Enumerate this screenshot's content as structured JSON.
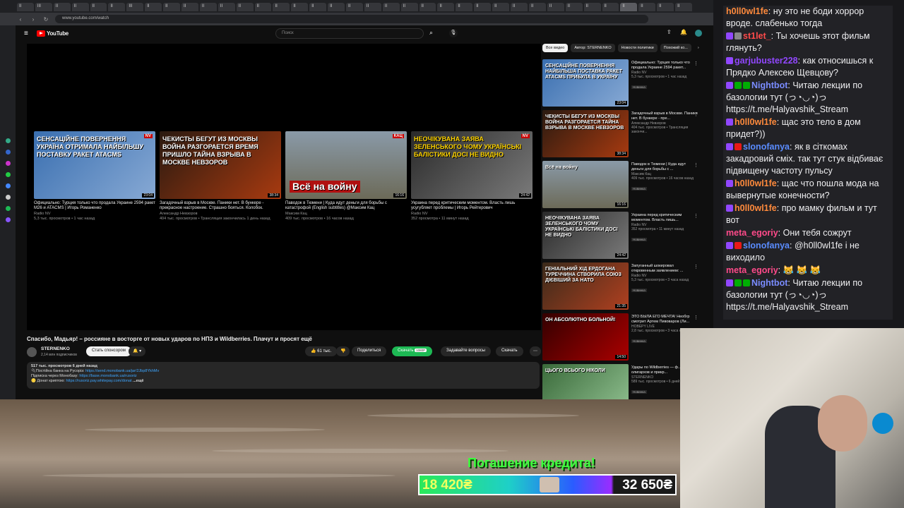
{
  "browser": {
    "tabs": [
      "II",
      "III",
      "II",
      "II",
      "II",
      "II",
      "III",
      "II",
      "II",
      "II",
      "II",
      "II",
      "II",
      "II",
      "II",
      "II",
      "II",
      "II",
      "II",
      "II",
      "II",
      "II",
      "II",
      "II",
      "II",
      "II",
      "II",
      "II",
      "II",
      "II",
      "II",
      "II",
      "II",
      "II",
      "II",
      "II",
      "II"
    ],
    "address": "www.youtube.com/watch"
  },
  "youtube": {
    "logo_text": "YouTube",
    "search_placeholder": "Поиск",
    "end_cards": [
      {
        "overlay": "СЕНСАЦІЙНЕ ПОВЕРНЕННЯ УКРАЇНА ОТРИМАЛА НАЙБІЛЬШУ ПОСТАВКУ РАКЕТ ATACMS",
        "badge": "NV",
        "duration": "23:04",
        "title": "Официально: Турция только что продала Украине 2594 ракет M26 и ATACMS | Игорь Романенко",
        "channel": "Radio NV",
        "meta": "5,3 тыс. просмотров • 1 час назад",
        "bg": "linear-gradient(135deg,#3a6fb0,#87a9d4)"
      },
      {
        "overlay": "ЧЕКИСТЫ БЕГУТ ИЗ МОСКВЫ ВОЙНА РАЗГОРАЕТСЯ ВРЕМЯ ПРИШЛО ТАЙНА ВЗРЫВА В МОСКВЕ НЕВЗОРОВ",
        "badge": "",
        "duration": "38:34",
        "title": "Загадочный взрыв в Москве. Паники нет. В бункере - прекрасное настроение. Страшно бояться. Колобок.",
        "channel": "Александр Невзоров",
        "meta": "404 тыс. просмотров • Трансляция закончилась 1 день назад",
        "bg": "linear-gradient(135deg,#2a1a10,#a83a10)"
      },
      {
        "overlay": "Всё на войну",
        "badge": "КАЦ",
        "duration": "16:16",
        "title": "Паводок в Тюмени | Куда идут деньги для борьбы с катастрофой (English subtitles) @Максим Кац",
        "channel": "Максим Кац",
        "meta": "409 тыс. просмотров • 16 часов назад",
        "bg": "linear-gradient(180deg,#8a9aa8,#6c6a58)"
      },
      {
        "overlay": "НЕОЧІКУВАНА ЗАЯВА ЗЕЛЕНСЬКОГО ЧОМУ УКРАЇНСЬКІ БАЛІСТИКИ ДОСІ НЕ ВИДНО",
        "badge": "NV",
        "duration": "24:42",
        "title": "Украина перед критическим моментом. Власть лишь усугубляет проблемы | Игорь Рейтерович",
        "channel": "Radio NV",
        "meta": "352 просмотра • 11 минут назад",
        "bg": "linear-gradient(135deg,#2a2a2a,#7a7a7a)"
      }
    ],
    "video_title": "Спасибо, Мадьяр! – россияне в восторге от новых ударов по НПЗ и Wildberries. Плачут и просят ещё",
    "channel_name": "STERNENKO",
    "subscribers": "2,14 млн подписчиков",
    "sponsor_label": "Стать спонсором",
    "likes": "61 тыс.",
    "share_label": "Поделиться",
    "download_label_green": "Скачать",
    "quality": "1080P",
    "ask_label": "Задавайте вопросы",
    "download_label": "Скачать",
    "description": {
      "stats": "517 тыс. просмотров  6 дней назад",
      "line1_prefix": "🔌Постійна банка на Русорiз: ",
      "line1_link": "https://send.monobank.ua/jar/2Jbp8YkhMv",
      "line2_prefix": "Підписка через Монобазу: ",
      "line2_link": "https://base.monobank.ua/rusoriz",
      "line3_prefix": "🪙 Донат криптою: ",
      "line3_link": "https://rusoriz.pay.whitepay.com/donat",
      "more": "...ещё"
    },
    "chips": [
      "Все видео",
      "Автор: STERNENKO",
      "Новости политики",
      "Похожий ко..."
    ],
    "recommendations": [
      {
        "overlay": "СЕНСАЦІЙНЕ ПОВЕРНЕННЯ НАЙБІЛЬША ПОСТАВКА РАКЕТ ATACMS ПРИБУЛА В УКРАЇНУ",
        "duration": "23:04",
        "title": "Официально: Турция только что продала Украине 2594 ракет...",
        "channel": "Radio NV",
        "meta": "5,3 тыс. просмотров • 1 час назад",
        "badge": "Новинка",
        "bg": "linear-gradient(135deg,#3a6fb0,#87a9d4)"
      },
      {
        "overlay": "ЧЕКИСТЫ БЕГУТ ИЗ МОСКВЫ ВОЙНА РАЗГОРАЕТСЯ ТАЙНА ВЗРЫВА В МОСКВЕ НЕВЗОРОВ",
        "duration": "38:34",
        "title": "Загадочный взрыв в Москве. Паники нет. В бункере - пре...",
        "channel": "Александр Невзоров",
        "meta": "404 тыс. просмотров • Трансляция закончи...",
        "badge": "",
        "bg": "linear-gradient(135deg,#2a1a10,#a83a10)"
      },
      {
        "overlay": "Всё на войну",
        "duration": "16:16",
        "title": "Паводок в Тюмени | Куда идут деньги для борьбы с ...",
        "channel": "Максим Кац",
        "meta": "409 тыс. просмотров • 16 часов назад",
        "badge": "Новинка",
        "bg": "linear-gradient(180deg,#8a9aa8,#6c6a58)"
      },
      {
        "overlay": "НЕОЧІКУВАНА ЗАЯВА ЗЕЛЕНСЬКОГО ЧОМУ УКРАЇНСЬКІ БАЛІСТИКИ ДОСІ НЕ ВИДНО",
        "duration": "24:42",
        "title": "Украина перед критическим моментом. Власть лишь...",
        "channel": "Radio NV",
        "meta": "352 просмотра • 11 минут назад",
        "badge": "Новинка",
        "bg": "linear-gradient(135deg,#2a2a2a,#7a7a7a)"
      },
      {
        "overlay": "ГЕНІАЛЬНИЙ ХІД ЕРДОГАНА ТУРЕЧЧИНА СТВОРИЛА СОЮЗ ДІЄВІШИЙ ЗА НАТО",
        "duration": "21:35",
        "title": "Запуганный шокировал откровенным заявлением: ...",
        "channel": "Radio NV",
        "meta": "5,3 тыс. просмотров • 3 часа назад",
        "badge": "Новинка",
        "bg": "linear-gradient(135deg,#3a2a1a,#b04020)"
      },
      {
        "overlay": "ОН АБСОЛЮТНО БОЛЬНОЙ!",
        "duration": "14:50",
        "title": "ЭТО БЫЛА ЕГО МЕЧТА! Необгр смотрит Артем Пивоваров (Ли...",
        "channel": "HOBEPY LIVE",
        "meta": "2,8 тыс. просмотров • 3 часа назад",
        "badge": "Новинка",
        "bg": "linear-gradient(135deg,#300,#a00)"
      },
      {
        "overlay": "ЦЬОГО ВСЬОГО НІКОЛИ",
        "duration": "",
        "title": "Удары по Wildberries — ф... Створ олигархов и прикр...",
        "channel": "STERNENKO",
        "meta": "589 тыс. просмотров • 6 дней назад",
        "badge": "Новинка",
        "bg": "linear-gradient(135deg,#3a6a3a,#90c090)"
      }
    ]
  },
  "chat": {
    "messages": [
      {
        "user": "h0ll0wl1fe",
        "color": "#ff8a3c",
        "text": "ну это не боди хоррор вроде. слабенько тогда",
        "badges": []
      },
      {
        "user": "st1let_",
        "color": "#ff4a4a",
        "text": "Ты хочешь этот фильм глянуть?",
        "badges": [
          "#9147ff",
          "#888"
        ]
      },
      {
        "user": "garjubuster228",
        "color": "#9147ff",
        "text": "как относишься к Прядко Алексею Щевцову?",
        "badges": [
          "#9147ff"
        ]
      },
      {
        "user": "Nightbot",
        "color": "#7a8cff",
        "text": "Читаю лекции по базологии тут (っ◔◡◔)っ https://t.me/Halyavshik_Stream",
        "badges": [
          "#9147ff",
          "#00ad03",
          "#00ad03"
        ]
      },
      {
        "user": "h0ll0wl1fe",
        "color": "#ff8a3c",
        "text": "щас это тело в дом придет?))",
        "badges": [
          "#9147ff"
        ]
      },
      {
        "user": "slonofanya",
        "color": "#5a8cff",
        "text": "як в сіткомах закадровий сміх. так тут стук відбиває підвищену частоту пульсу",
        "badges": [
          "#9147ff",
          "#e91916"
        ]
      },
      {
        "user": "h0ll0wl1fe",
        "color": "#ff8a3c",
        "text": "щас что пошла мода на вывернутые конечности?",
        "badges": [
          "#9147ff"
        ]
      },
      {
        "user": "h0ll0wl1fe",
        "color": "#ff8a3c",
        "text": "про мамку фильм и тут вот",
        "badges": [
          "#9147ff"
        ]
      },
      {
        "user": "meta_egoriy",
        "color": "#ff4a8a",
        "text": "Они тебя сожрут",
        "badges": []
      },
      {
        "user": "slonofanya",
        "color": "#5a8cff",
        "text": "@h0ll0wl1fe і не виходило",
        "badges": [
          "#9147ff",
          "#e91916"
        ]
      },
      {
        "user": "meta_egoriy",
        "color": "#ff4a8a",
        "text": "😹 😹 😹",
        "badges": []
      },
      {
        "user": "Nightbot",
        "color": "#7a8cff",
        "text": "Читаю лекции по базологии тут (っ◔◡◔)っ https://t.me/Halyavshik_Stream",
        "badges": [
          "#9147ff",
          "#00ad03",
          "#00ad03"
        ]
      }
    ]
  },
  "overlay": {
    "banner_title": "Погашение кредита!",
    "balance_left": "18 420₴",
    "balance_right": "32 650₴"
  }
}
